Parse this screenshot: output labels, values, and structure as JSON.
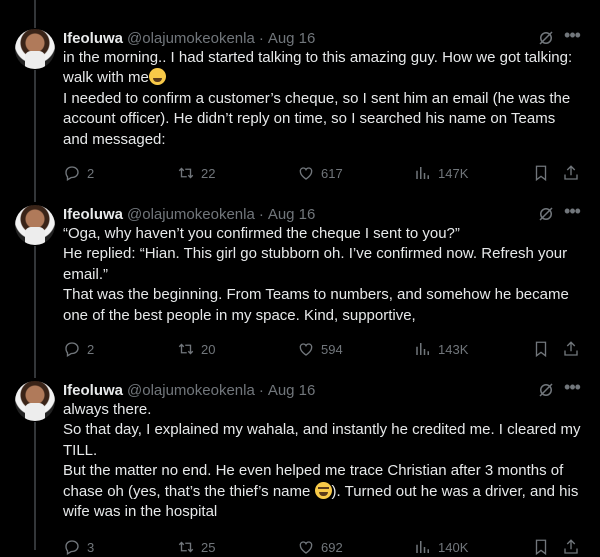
{
  "tweets": [
    {
      "author_name": "Ifeoluwa",
      "author_handle": "@olajumokeokenla",
      "separator": "·",
      "date": "Aug 16",
      "text_lines": [
        "in the morning.. I had started talking to this amazing guy. How we got talking: walk with me",
        "I needed to confirm a customer’s cheque, so I sent him an email (he was the account officer). He didn’t reply on time, so I searched his name on Teams and messaged:"
      ],
      "emoji": "😂",
      "replies": "2",
      "reposts": "22",
      "likes": "617",
      "views": "147K"
    },
    {
      "author_name": "Ifeoluwa",
      "author_handle": "@olajumokeokenla",
      "separator": "·",
      "date": "Aug 16",
      "text_lines": [
        "“Oga, why haven’t you confirmed the cheque I sent to you?”",
        "He replied: “Hian. This girl go stubborn oh. I’ve confirmed now. Refresh your email.”",
        "That was the beginning. From Teams to numbers, and somehow he became one of the best people in my space. Kind, supportive,"
      ],
      "replies": "2",
      "reposts": "20",
      "likes": "594",
      "views": "143K"
    },
    {
      "author_name": "Ifeoluwa",
      "author_handle": "@olajumokeokenla",
      "separator": "·",
      "date": "Aug 16",
      "text_lines": [
        "always there.",
        "So that day, I explained my wahala, and instantly he credited me. I cleared my TILL.",
        "But the matter no end. He even helped me trace Christian after 3 months of chase oh (yes, that’s the thief’s name",
        "). Turned out he was a driver, and his wife was in the hospital"
      ],
      "emoji": "😩",
      "replies": "3",
      "reposts": "25",
      "likes": "692",
      "views": "140K"
    }
  ],
  "icons": {
    "more": "more-horizontal-icon",
    "grok": "grok-icon",
    "reply": "reply-icon",
    "repost": "repost-icon",
    "like": "heart-icon",
    "views": "views-icon",
    "bookmark": "bookmark-icon",
    "share": "share-icon"
  },
  "colors": {
    "background": "#000000",
    "text": "#e7e9ea",
    "muted": "#71767b",
    "thread_line": "#333639"
  }
}
